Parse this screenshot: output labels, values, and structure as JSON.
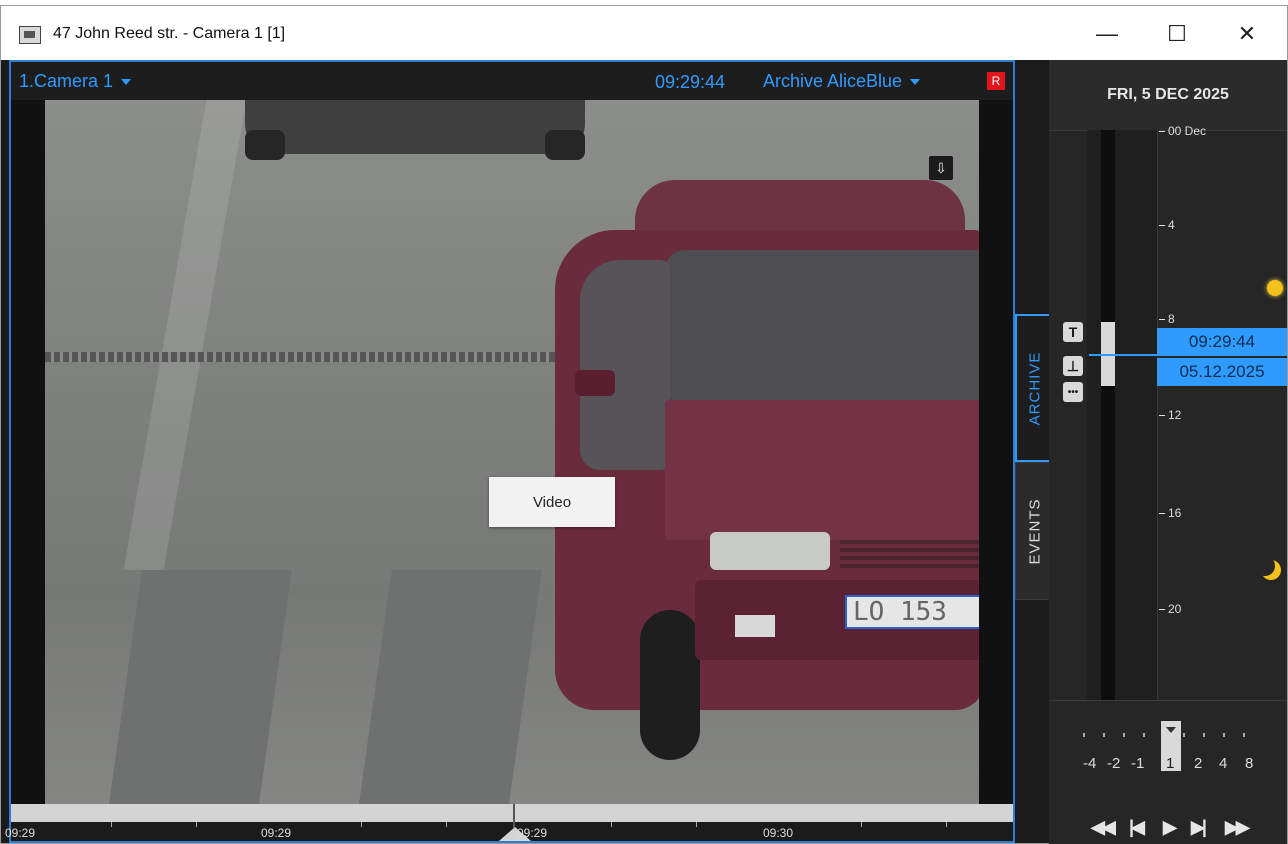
{
  "window": {
    "title": "47 John Reed str. - Camera 1 [1]",
    "minimize_glyph": "—",
    "maximize_glyph": "☐",
    "close_glyph": "✕"
  },
  "video": {
    "camera_label": "1.Camera 1",
    "time": "09:29:44",
    "archive_label": "Archive AliceBlue",
    "rec_badge": "R",
    "popup_label": "Video",
    "plate_text": "LO 153",
    "export_icon_glyph": "⇩",
    "bookmark_icon_glyph": "⚑"
  },
  "timeline": {
    "labels": [
      "09:29",
      "09:29",
      "09:29",
      "09:30"
    ]
  },
  "sidebar": {
    "date": "FRI, 5 DEC 2025",
    "hours": [
      "00 Dec",
      "4",
      "8",
      "12",
      "16",
      "20"
    ],
    "cursor_time": "09:29:44",
    "cursor_date": "05.12.2025",
    "btn_top": "T",
    "btn_bottom": "⊥",
    "btn_more": "•••"
  },
  "tabs": {
    "archive": "ARCHIVE",
    "events": "EVENTS"
  },
  "speed": {
    "labels": [
      "-4",
      "-2",
      "-1",
      "1",
      "2",
      "4",
      "8"
    ],
    "selected": "1"
  },
  "playback": {
    "rewind": "◀◀",
    "prev_frame": "|◀",
    "play": "▶",
    "next_frame": "▶|",
    "fast_forward": "▶▶"
  },
  "colors": {
    "accent": "#2f9bff",
    "record": "#e2141c",
    "panel_dark": "#1b1b1b"
  }
}
